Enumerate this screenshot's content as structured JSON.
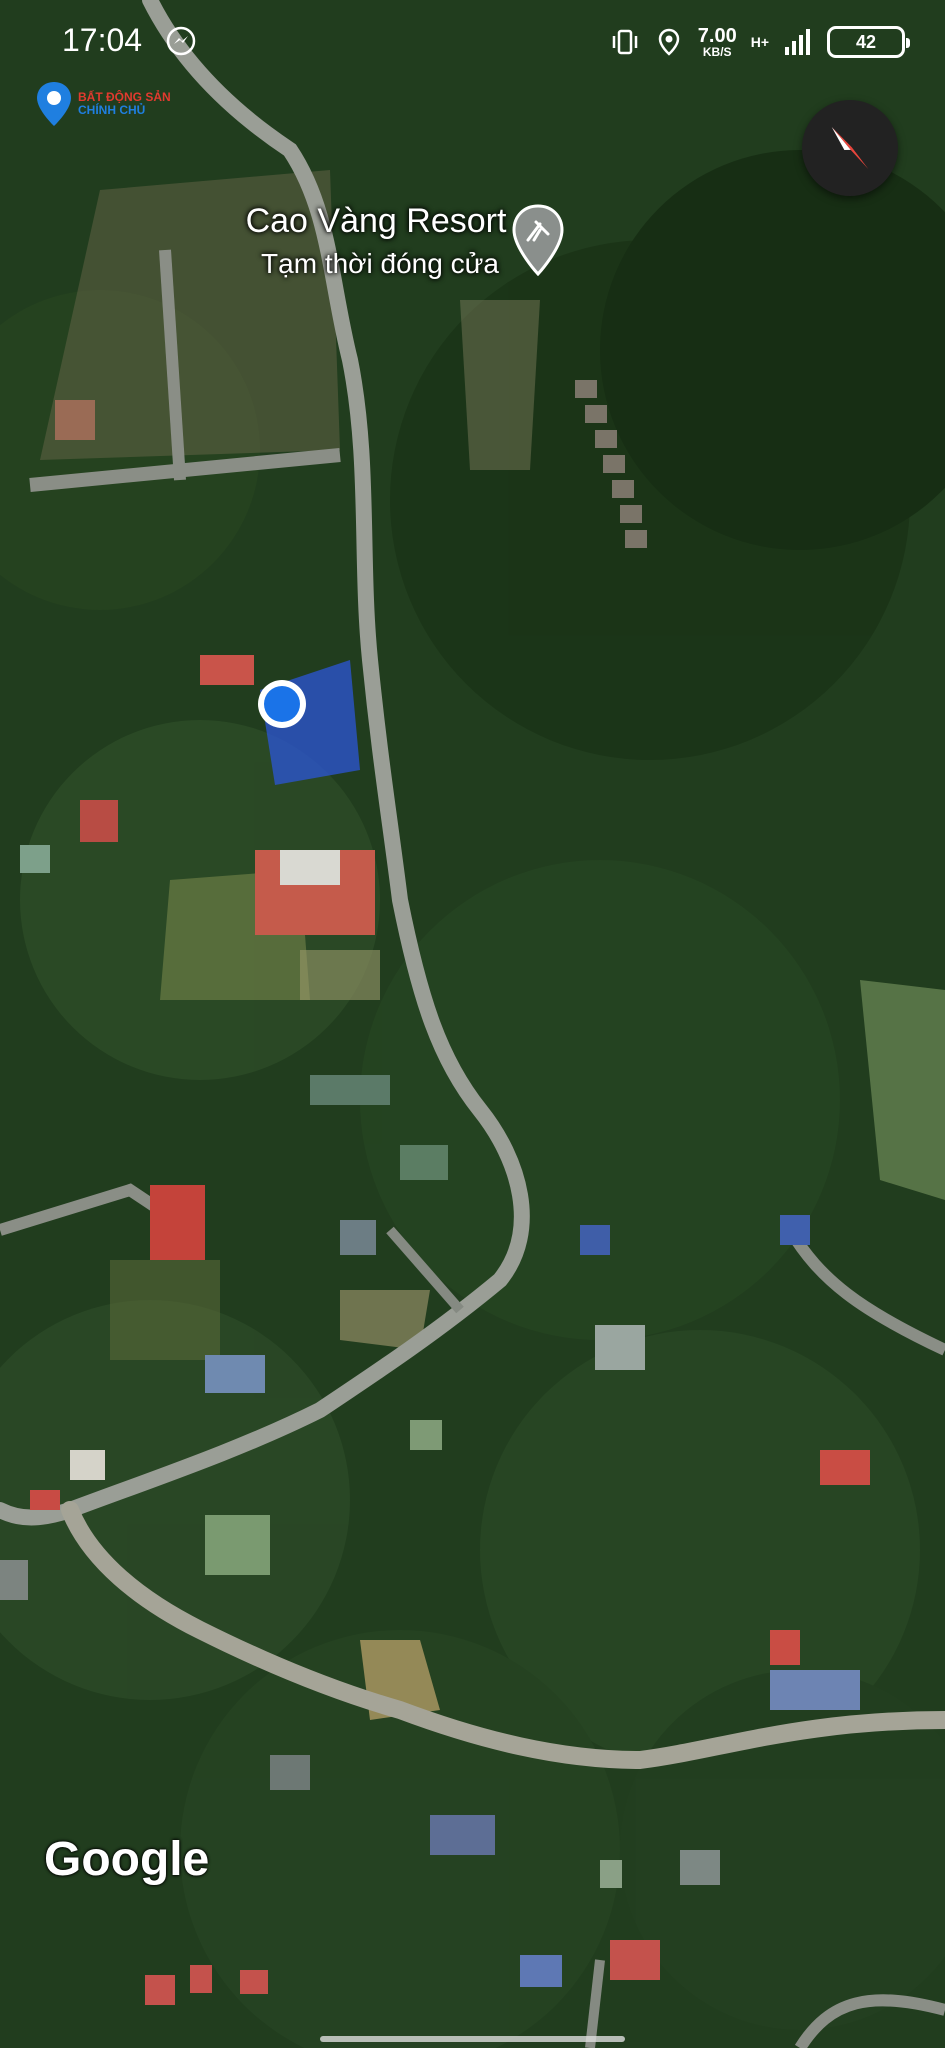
{
  "status_bar": {
    "time": "17:04",
    "network_speed_value": "7.00",
    "network_speed_unit": "KB/S",
    "network_type": "H+",
    "battery_level": "42"
  },
  "watermark": {
    "line1": "BẤT ĐỘNG SẢN",
    "line2": "CHÍNH CHỦ"
  },
  "map": {
    "view": "satellite",
    "place": {
      "name": "Cao Vàng Resort",
      "status": "Tạm thời đóng cửa",
      "icon": "hiking-pin-icon"
    },
    "current_location_icon": "blue-dot-icon",
    "attribution": "Google"
  },
  "colors": {
    "forest_dark": "#1f3a1c",
    "forest_mid": "#2e5028",
    "road": "#9aa09a",
    "location_blue": "#1a73e8",
    "compass_red": "#e8453c"
  }
}
